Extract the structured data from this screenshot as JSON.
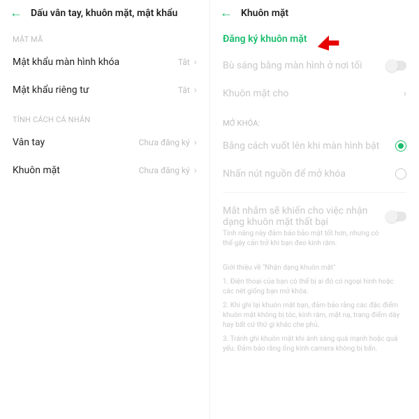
{
  "left": {
    "title": "Dấu vân tay, khuôn mặt, mật khẩu",
    "section1": "MẬT MÃ",
    "row1_label": "Mật khẩu màn hình khóa",
    "row1_value": "Tắt",
    "row2_label": "Mật khẩu riêng tư",
    "row2_value": "Tắt",
    "section2": "TÍNH CÁCH CÁ NHÂN",
    "row3_label": "Vân tay",
    "row3_value": "Chưa đăng ký",
    "row4_label": "Khuôn mặt",
    "row4_value": "Chưa đăng ký"
  },
  "right": {
    "title": "Khuôn mặt",
    "register": "Đăng ký khuôn mặt",
    "row_brightness": "Bù sáng bằng màn hình ở nơi tối",
    "row_facefor": "Khuôn mặt cho",
    "section_unlock": "MỞ KHÓA:",
    "radio1": "Bằng cách vuốt lên khi màn hình bật",
    "radio2": "Nhấn nút nguồn để mở khóa",
    "eyes_title": "Mắt nhắm sẽ khiến cho việc nhận dạng khuôn mặt thất bại",
    "eyes_desc": "Tính năng này đảm bảo bảo mật tốt hơn, nhưng có thể gây cản trở khi bạn đeo kính râm.",
    "intro_title": "Giới thiệu về \"Nhận dạng khuôn mặt\"",
    "intro_1": "1. Điện thoại của bạn có thể bị ai đó có ngoại hình hoặc các nét giống bạn mở khóa.",
    "intro_2": "2. Khi ghi lại khuôn mặt bạn, đảm bảo rằng các đặc điểm khuôn mặt không bị tóc, kính râm, mặt nạ, trang điểm dày hay bất cứ thứ gì khác che phủ.",
    "intro_3": "3. Tránh ghi khuôn mặt khi ánh sáng quá mạnh hoặc quá yếu. Đảm bảo rằng ống kính camera không bị bẩn."
  }
}
